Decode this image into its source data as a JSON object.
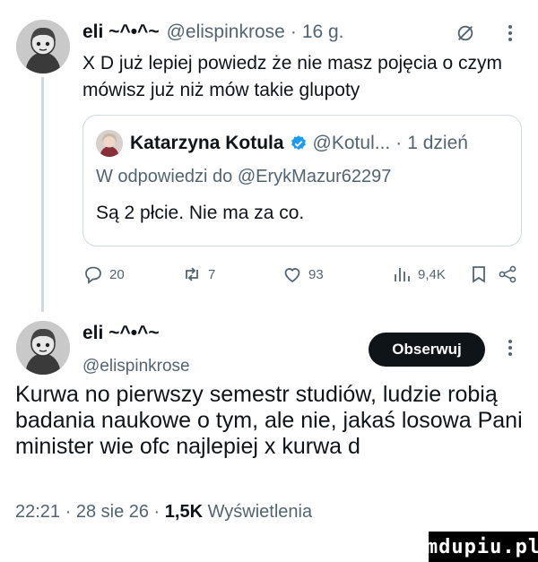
{
  "tweet_reply": {
    "display_name": "eli ~^•^~",
    "handle": "@elispinkrose",
    "time": "16 g.",
    "separator": "·",
    "text": "X D już lepiej powiedz że nie masz pojęcia o czym mówisz już niż mów takie glupoty",
    "quoted": {
      "display_name": "Katarzyna Kotula",
      "handle": "@Kotul...",
      "time": "1 dzień",
      "reply_context": "W odpowiedzi do @ErykMazur62297",
      "text": "Są 2 płcie. Nie ma za co."
    },
    "actions": {
      "replies": "20",
      "reposts": "7",
      "likes": "93",
      "views": "9,4K"
    }
  },
  "main_tweet": {
    "display_name": "eli ~^•^~",
    "handle": "@elispinkrose",
    "follow_label": "Obserwuj",
    "text": "Kurwa no pierwszy semestr studiów, ludzie robią badania naukowe o tym, ale nie, jakaś losowa Pani minister wie ofc najlepiej x kurwa d",
    "timestamp": "22:21 · 28 sie 26 ·",
    "views_count": "1,5K",
    "views_label": "Wyświetlenia"
  },
  "watermark": "mdupiu.pl",
  "colors": {
    "text": "#0f1419",
    "muted": "#536471",
    "border": "#cfd9de",
    "verified": "#1d9bf0",
    "button_bg": "#0f1419"
  },
  "icons": [
    "avatar",
    "grok-icon",
    "more-icon",
    "verified-badge-icon",
    "reply-icon",
    "repost-icon",
    "like-icon",
    "views-icon",
    "bookmark-icon",
    "share-icon"
  ]
}
